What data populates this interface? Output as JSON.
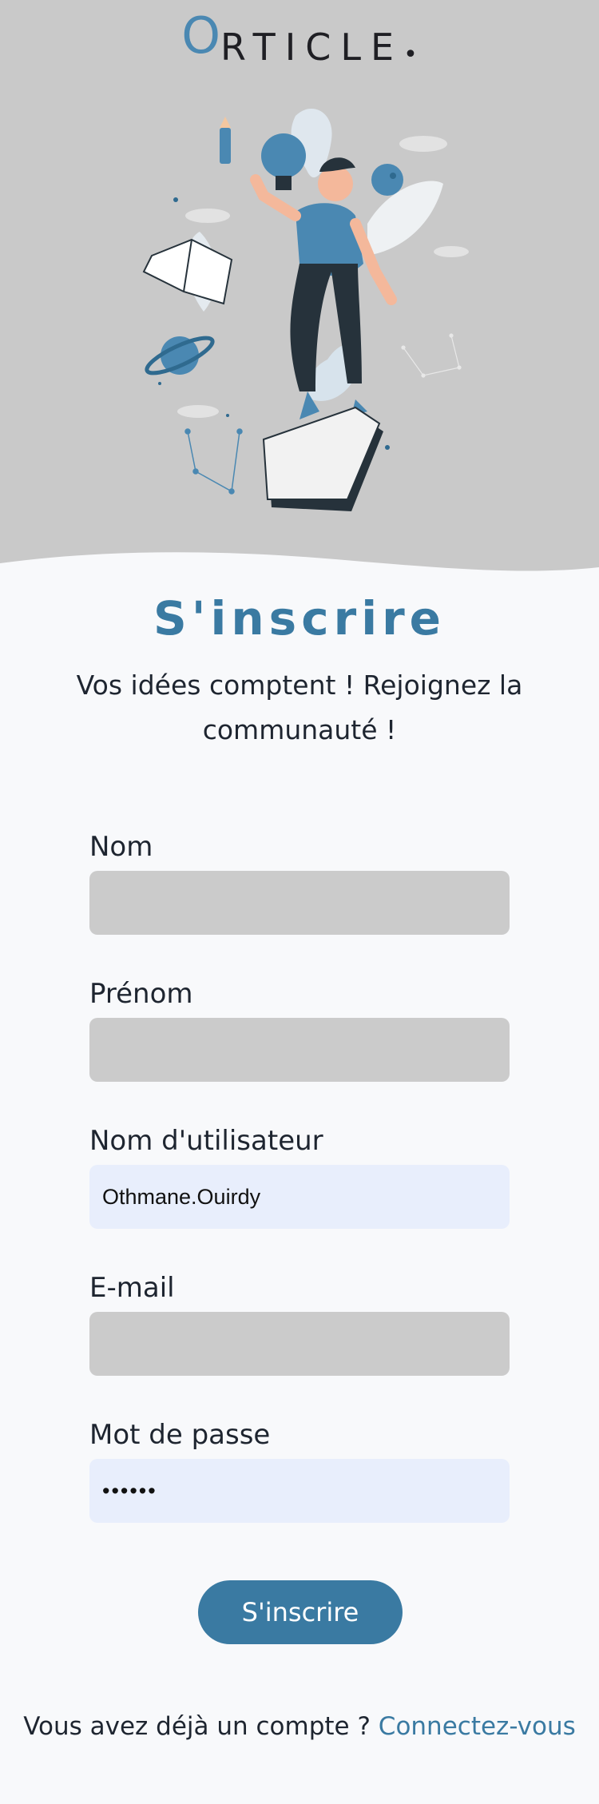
{
  "brand": {
    "logo_initial": "O",
    "logo_rest": "RTICLE",
    "logo_dot": "•"
  },
  "header": {
    "title": "S'inscrire",
    "subtitle": "Vos idées comptent ! Rejoignez la communauté !"
  },
  "form": {
    "fields": [
      {
        "label": "Nom",
        "value": "",
        "type": "text",
        "filled": false
      },
      {
        "label": "Prénom",
        "value": "",
        "type": "text",
        "filled": false
      },
      {
        "label": "Nom d'utilisateur",
        "value": "Othmane.Ouirdy",
        "type": "text",
        "filled": true
      },
      {
        "label": "E-mail",
        "value": "",
        "type": "email",
        "filled": false
      },
      {
        "label": "Mot de passe",
        "value": "••••••",
        "type": "password",
        "filled": true
      }
    ],
    "submit_label": "S'inscrire"
  },
  "footer": {
    "text": "Vous avez déjà un compte ?",
    "link_label": "Connectez-vous"
  },
  "colors": {
    "accent": "#3a7aa2",
    "hero_bg": "#c9c9c9",
    "page_bg": "#f8f9fb",
    "input_empty": "#cbcbcb",
    "input_filled": "#e8eefc"
  }
}
